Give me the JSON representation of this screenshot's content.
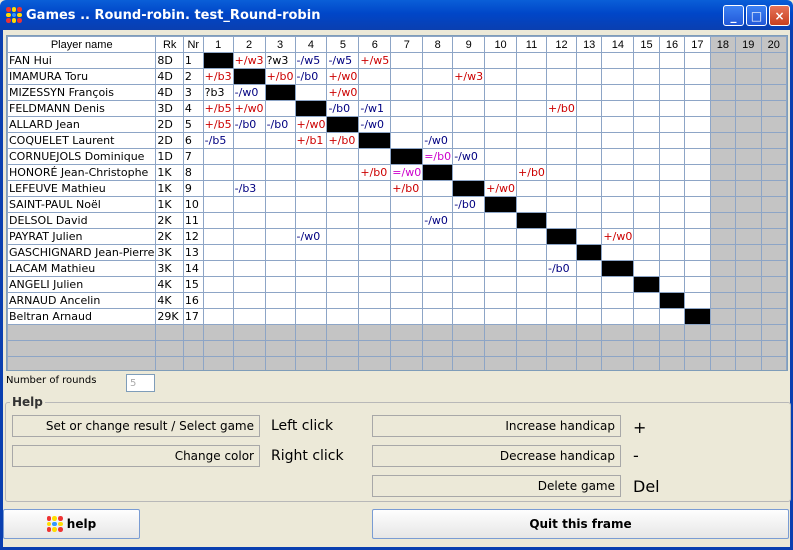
{
  "window": {
    "title": "Games .. Round-robin. test_Round-robin",
    "minimize": "_",
    "maximize": "□",
    "close": "×"
  },
  "table": {
    "headers": [
      "Player name",
      "Rk",
      "Nr",
      "1",
      "2",
      "3",
      "4",
      "5",
      "6",
      "7",
      "8",
      "9",
      "10",
      "11",
      "12",
      "13",
      "14",
      "15",
      "16",
      "17",
      "18",
      "19",
      "20"
    ],
    "players": [
      {
        "name": "FAN Hui",
        "rank": "8D",
        "nr": "1",
        "results": {
          "2": "+/w3",
          "3": "?w3",
          "4": "-/w5",
          "5": "-/w5",
          "6": "+/w5"
        }
      },
      {
        "name": "IMAMURA Toru",
        "rank": "4D",
        "nr": "2",
        "results": {
          "1": "+/b3",
          "3": "+/b0",
          "4": "-/b0",
          "5": "+/w0",
          "9": "+/w3"
        }
      },
      {
        "name": "MIZESSYN François",
        "rank": "4D",
        "nr": "3",
        "results": {
          "1": "?b3",
          "2": "-/w0",
          "5": "+/w0"
        }
      },
      {
        "name": "FELDMANN Denis",
        "rank": "3D",
        "nr": "4",
        "results": {
          "1": "+/b5",
          "2": "+/w0",
          "5": "-/b0",
          "6": "-/w1",
          "12": "+/b0"
        }
      },
      {
        "name": "ALLARD Jean",
        "rank": "2D",
        "nr": "5",
        "results": {
          "1": "+/b5",
          "2": "-/b0",
          "3": "-/b0",
          "4": "+/w0",
          "6": "-/w0"
        }
      },
      {
        "name": "COQUELET Laurent",
        "rank": "2D",
        "nr": "6",
        "results": {
          "1": "-/b5",
          "4": "+/b1",
          "5": "+/b0",
          "8": "-/w0"
        }
      },
      {
        "name": "CORNUEJOLS Dominique",
        "rank": "1D",
        "nr": "7",
        "results": {
          "8": "=/b0",
          "9": "-/w0"
        }
      },
      {
        "name": "HONORÉ Jean-Christophe",
        "rank": "1K",
        "nr": "8",
        "results": {
          "6": "+/b0",
          "7": "=/w0",
          "11": "+/b0"
        }
      },
      {
        "name": "LEFEUVE Mathieu",
        "rank": "1K",
        "nr": "9",
        "results": {
          "2": "-/b3",
          "7": "+/b0",
          "10": "+/w0"
        }
      },
      {
        "name": "SAINT-PAUL Noël",
        "rank": "1K",
        "nr": "10",
        "results": {
          "9": "-/b0"
        }
      },
      {
        "name": "DELSOL David",
        "rank": "2K",
        "nr": "11",
        "results": {
          "8": "-/w0"
        }
      },
      {
        "name": "PAYRAT Julien",
        "rank": "2K",
        "nr": "12",
        "results": {
          "4": "-/w0",
          "14": "+/w0"
        }
      },
      {
        "name": "GASCHIGNARD Jean-Pierre",
        "rank": "3K",
        "nr": "13",
        "results": {}
      },
      {
        "name": "LACAM Mathieu",
        "rank": "3K",
        "nr": "14",
        "results": {
          "12": "-/b0"
        }
      },
      {
        "name": "ANGELI Julien",
        "rank": "4K",
        "nr": "15",
        "results": {}
      },
      {
        "name": "ARNAUD Ancelin",
        "rank": "4K",
        "nr": "16",
        "results": {}
      },
      {
        "name": "Beltran Arnaud",
        "rank": "29K",
        "nr": "17",
        "results": {}
      }
    ],
    "colors": {
      "win": "#cc0000",
      "loss": "#000080",
      "draw": "#cc00cc",
      "pending": "#000000"
    }
  },
  "rounds": {
    "label": "Number of rounds",
    "value": "5"
  },
  "help": {
    "legend": "Help",
    "set_result_button": "Set or change result / Select game",
    "set_result_hint": "Left click",
    "change_color_button": "Change color",
    "change_color_hint": "Right click",
    "increase_button": "Increase handicap",
    "increase_hint": "+",
    "decrease_button": "Decrease handicap",
    "decrease_hint": "-",
    "delete_button": "Delete game",
    "delete_hint": "Del"
  },
  "bottom": {
    "help_button": "help",
    "quit_button": "Quit this frame"
  }
}
